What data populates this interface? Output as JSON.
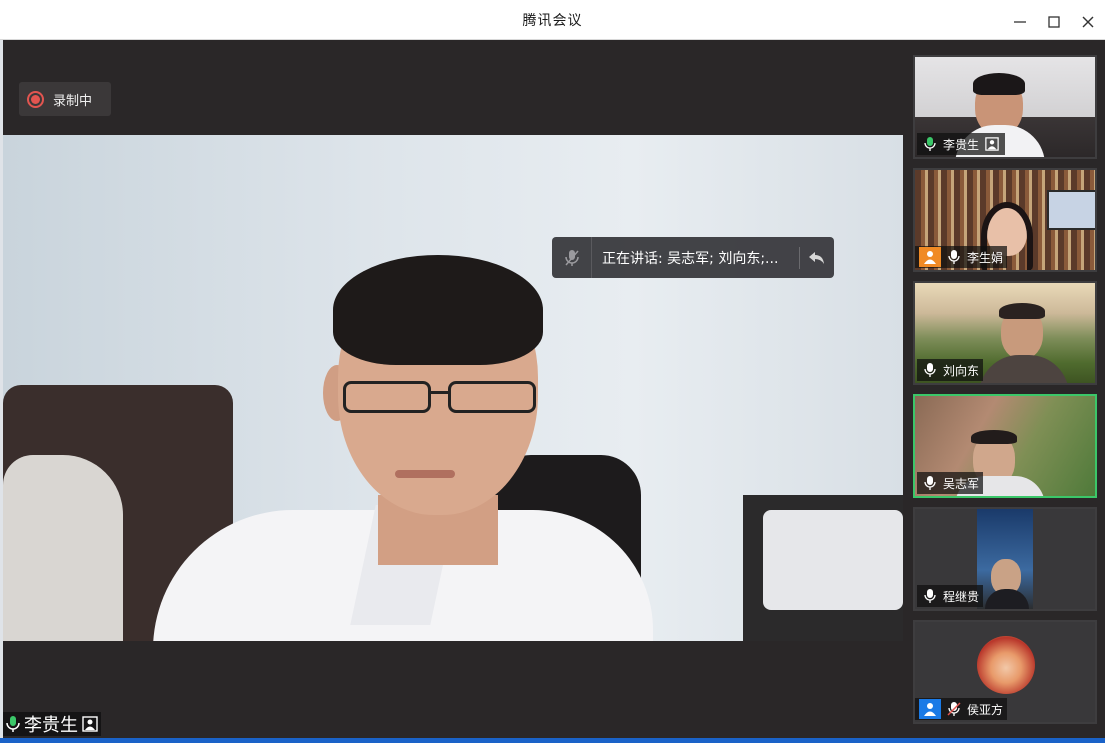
{
  "window": {
    "title": "腾讯会议",
    "controls": [
      "minimize-icon",
      "maximize-icon",
      "close-icon"
    ]
  },
  "recording": {
    "label": "录制中",
    "color": "#e25550"
  },
  "speaking": {
    "text": "正在讲话: 吴志军; 刘向东;..."
  },
  "main_video": {
    "participant": "李贵生"
  },
  "participants": [
    {
      "name": "李贵生",
      "mic": "on",
      "badge": "screen-share"
    },
    {
      "name": "李生娟",
      "mic": "on",
      "badge": "avatar-orange"
    },
    {
      "name": "刘向东",
      "mic": "on"
    },
    {
      "name": "吴志军",
      "mic": "on",
      "active": true
    },
    {
      "name": "程继贵",
      "mic": "on"
    },
    {
      "name": "侯亚方",
      "mic": "muted",
      "badge": "avatar-blue"
    }
  ],
  "colors": {
    "accent_green": "#3bc769",
    "accent_blue": "#1a7ae6"
  }
}
